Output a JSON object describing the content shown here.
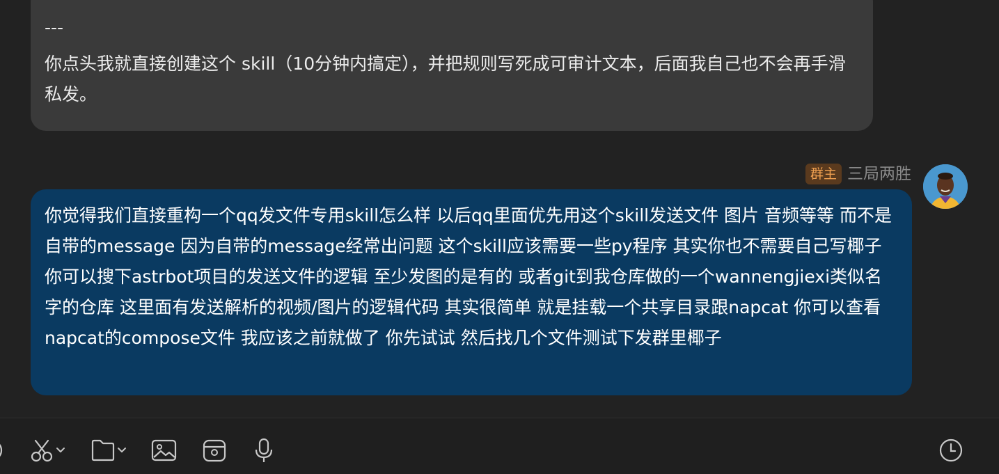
{
  "messages": {
    "incoming": {
      "separator": "---",
      "text": "你点头我就直接创建这个 skill（10分钟内搞定），并把规则写死成可审计文本，后面我自己也不会再手滑私发。"
    },
    "outgoing": {
      "sender_role": "群主",
      "sender_name": "三局两胜",
      "text": "你觉得我们直接重构一个qq发文件专用skill怎么样 以后qq里面优先用这个skill发送文件 图片 音频等等 而不是自带的message 因为自带的message经常出问题 这个skill应该需要一些py程序 其实你也不需要自己写椰子 你可以搜下astrbot项目的发送文件的逻辑 至少发图的是有的 或者git到我仓库做的一个wannengjiexi类似名字的仓库 这里面有发送解析的视频/图片的逻辑代码 其实很简单 就是挂载一个共享目录跟napcat 你可以查看napcat的compose文件 我应该之前就做了 你先试试 然后找几个文件测试下发群里椰子"
    }
  },
  "toolbar": {
    "icons": [
      "emoji-icon",
      "scissors-icon",
      "folder-icon",
      "image-icon",
      "sticker-icon",
      "microphone-icon",
      "history-clock-icon"
    ]
  },
  "colors": {
    "background": "#222222",
    "incoming_bubble": "#3a3a3a",
    "outgoing_bubble": "#0a3a61",
    "role_badge_bg": "#5a3a1e",
    "role_badge_text": "#f0a050"
  }
}
